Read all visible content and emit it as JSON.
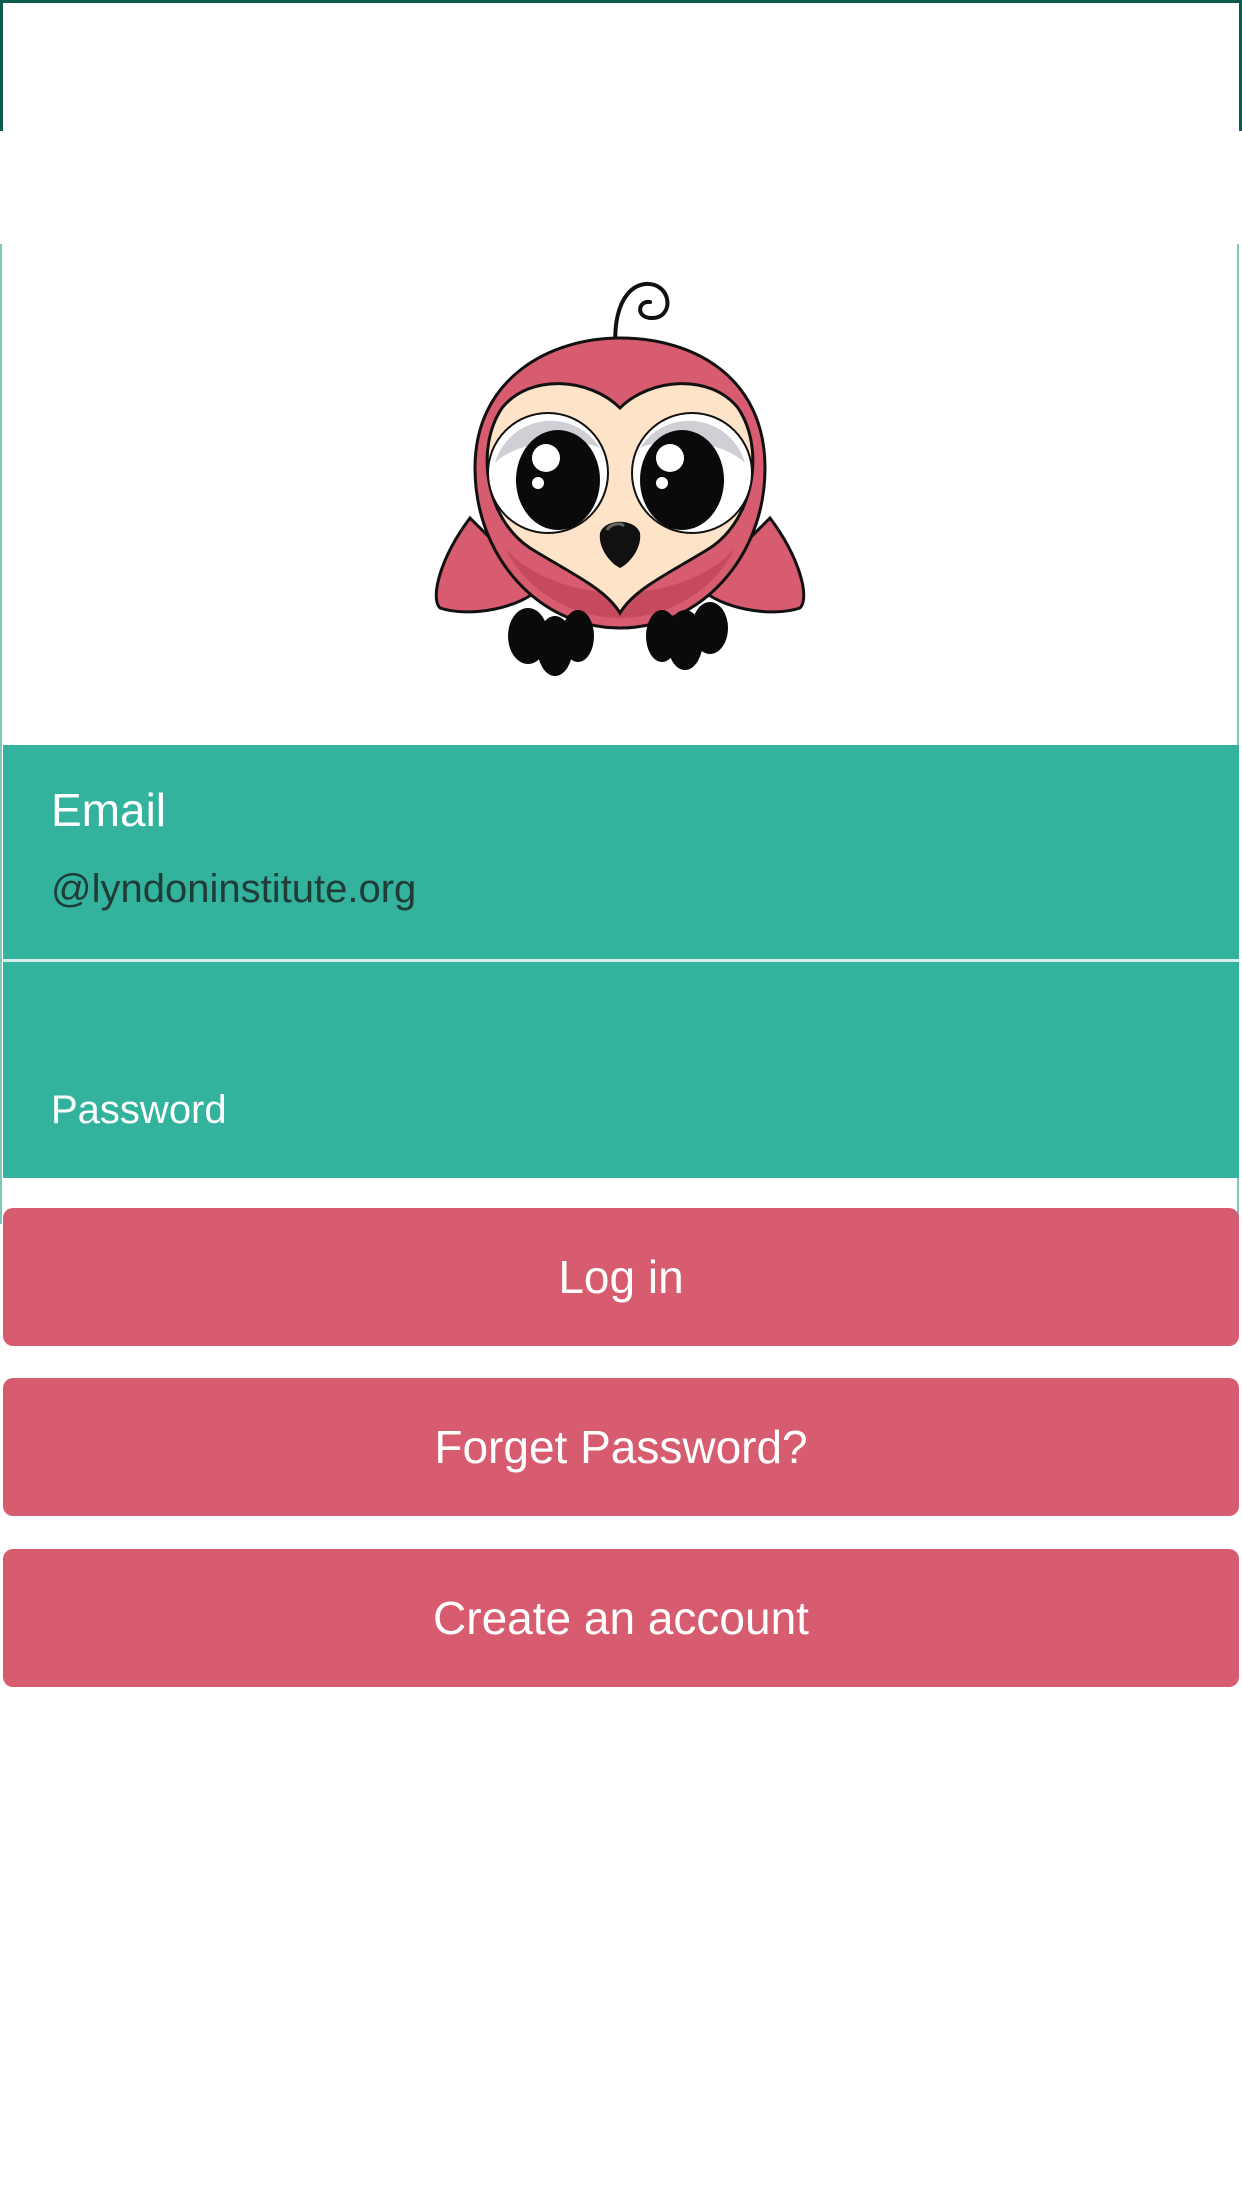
{
  "header": {},
  "logo": {
    "icon": "owl-mascot-icon",
    "colors": {
      "body": "#d85c6f",
      "face": "#fde3c7",
      "eyes": "#0a0a0a"
    }
  },
  "form": {
    "email": {
      "label": "Email",
      "value": "@lyndoninstitute.org"
    },
    "password": {
      "label": "Password"
    }
  },
  "buttons": {
    "login": "Log in",
    "forget_password": "Forget Password?",
    "create_account": "Create an account"
  },
  "colors": {
    "teal": "#33b29d",
    "pink": "#d85c6f",
    "header_border": "#0c5c4e"
  }
}
